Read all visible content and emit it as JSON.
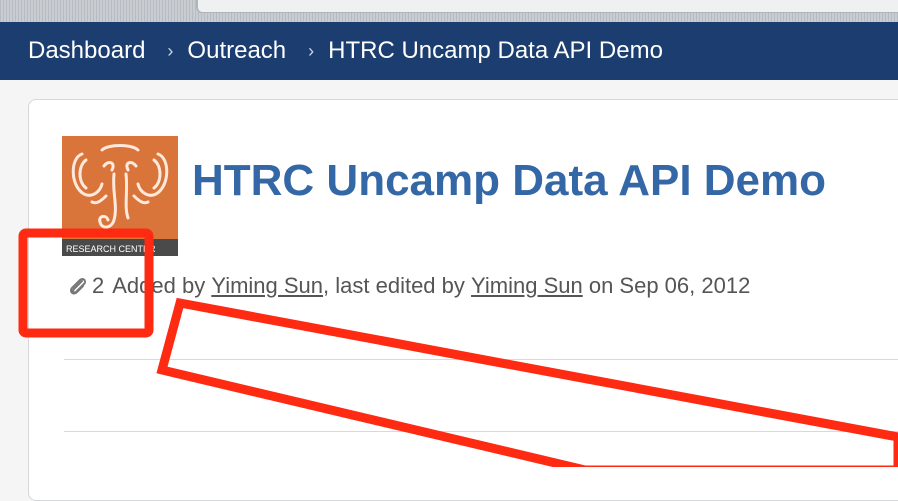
{
  "breadcrumb": {
    "items": [
      "Dashboard",
      "Outreach",
      "HTRC Uncamp Data API Demo"
    ],
    "separator": "›"
  },
  "page": {
    "title": "HTRC Uncamp Data API Demo",
    "logo_text": "RESEARCH CENTER"
  },
  "meta": {
    "attachment_count": "2",
    "added_by_prefix": "Added by",
    "author": "Yiming Sun",
    "edited_prefix": ", last edited by",
    "editor": "Yiming Sun",
    "date_text": "on Sep 06, 2012"
  },
  "colors": {
    "nav_bg": "#1b3d6f",
    "title": "#3467a6",
    "logo_bg": "#d9743a",
    "annotation": "#ff2a12"
  }
}
